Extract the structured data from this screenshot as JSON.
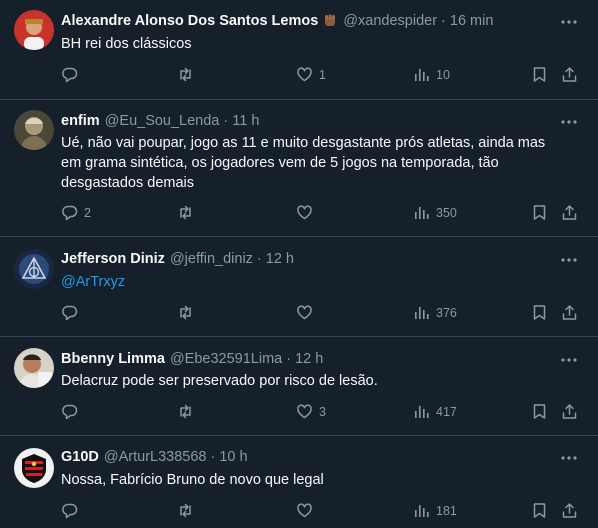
{
  "tweets": [
    {
      "name": "Alexandre Alonso Dos Santos Lemos",
      "emoji_icon": "raised-fist-emoji",
      "handle": "@xandespider",
      "time": "16 min",
      "text": "BH rei dos clássicos",
      "replies": "",
      "retweets": "",
      "likes": "1",
      "views": "10"
    },
    {
      "name": "enfim",
      "handle": "@Eu_Sou_Lenda",
      "time": "11 h",
      "text_lines": [
        "Ué, não vai poupar, jogo as 11 e muito desgastante prós atletas, ainda mas",
        "em grama sintética, os jogadores vem de 5 jogos na temporada, tão",
        "desgastados demais"
      ],
      "replies": "2",
      "retweets": "",
      "likes": "",
      "views": "350"
    },
    {
      "name": "Jefferson Diniz",
      "handle": "@jeffin_diniz",
      "time": "12 h",
      "mention": "@ArTrxyz",
      "replies": "",
      "retweets": "",
      "likes": "",
      "views": "376"
    },
    {
      "name": "Bbenny Limma",
      "handle": "@Ebe32591Lima",
      "time": "12 h",
      "text": "Delacruz pode ser preservado por risco de lesão.",
      "replies": "",
      "retweets": "",
      "likes": "3",
      "views": "417"
    },
    {
      "name": "G10D",
      "handle": "@ArturL338568",
      "time": "10 h",
      "text": "Nossa, Fabrício Bruno de novo que legal",
      "replies": "",
      "retweets": "",
      "likes": "",
      "views": "181"
    }
  ],
  "separator": "·",
  "colors": {
    "background": "#15202b",
    "divider": "#38444d",
    "primary_text": "#f7f9f9",
    "secondary_text": "#8b98a5",
    "link": "#1d9bf0"
  },
  "icons": {
    "reply": "reply-icon",
    "retweet": "retweet-icon",
    "like": "heart-icon",
    "views": "views-chart-icon",
    "bookmark": "bookmark-icon",
    "share": "share-icon",
    "more": "more-icon"
  }
}
